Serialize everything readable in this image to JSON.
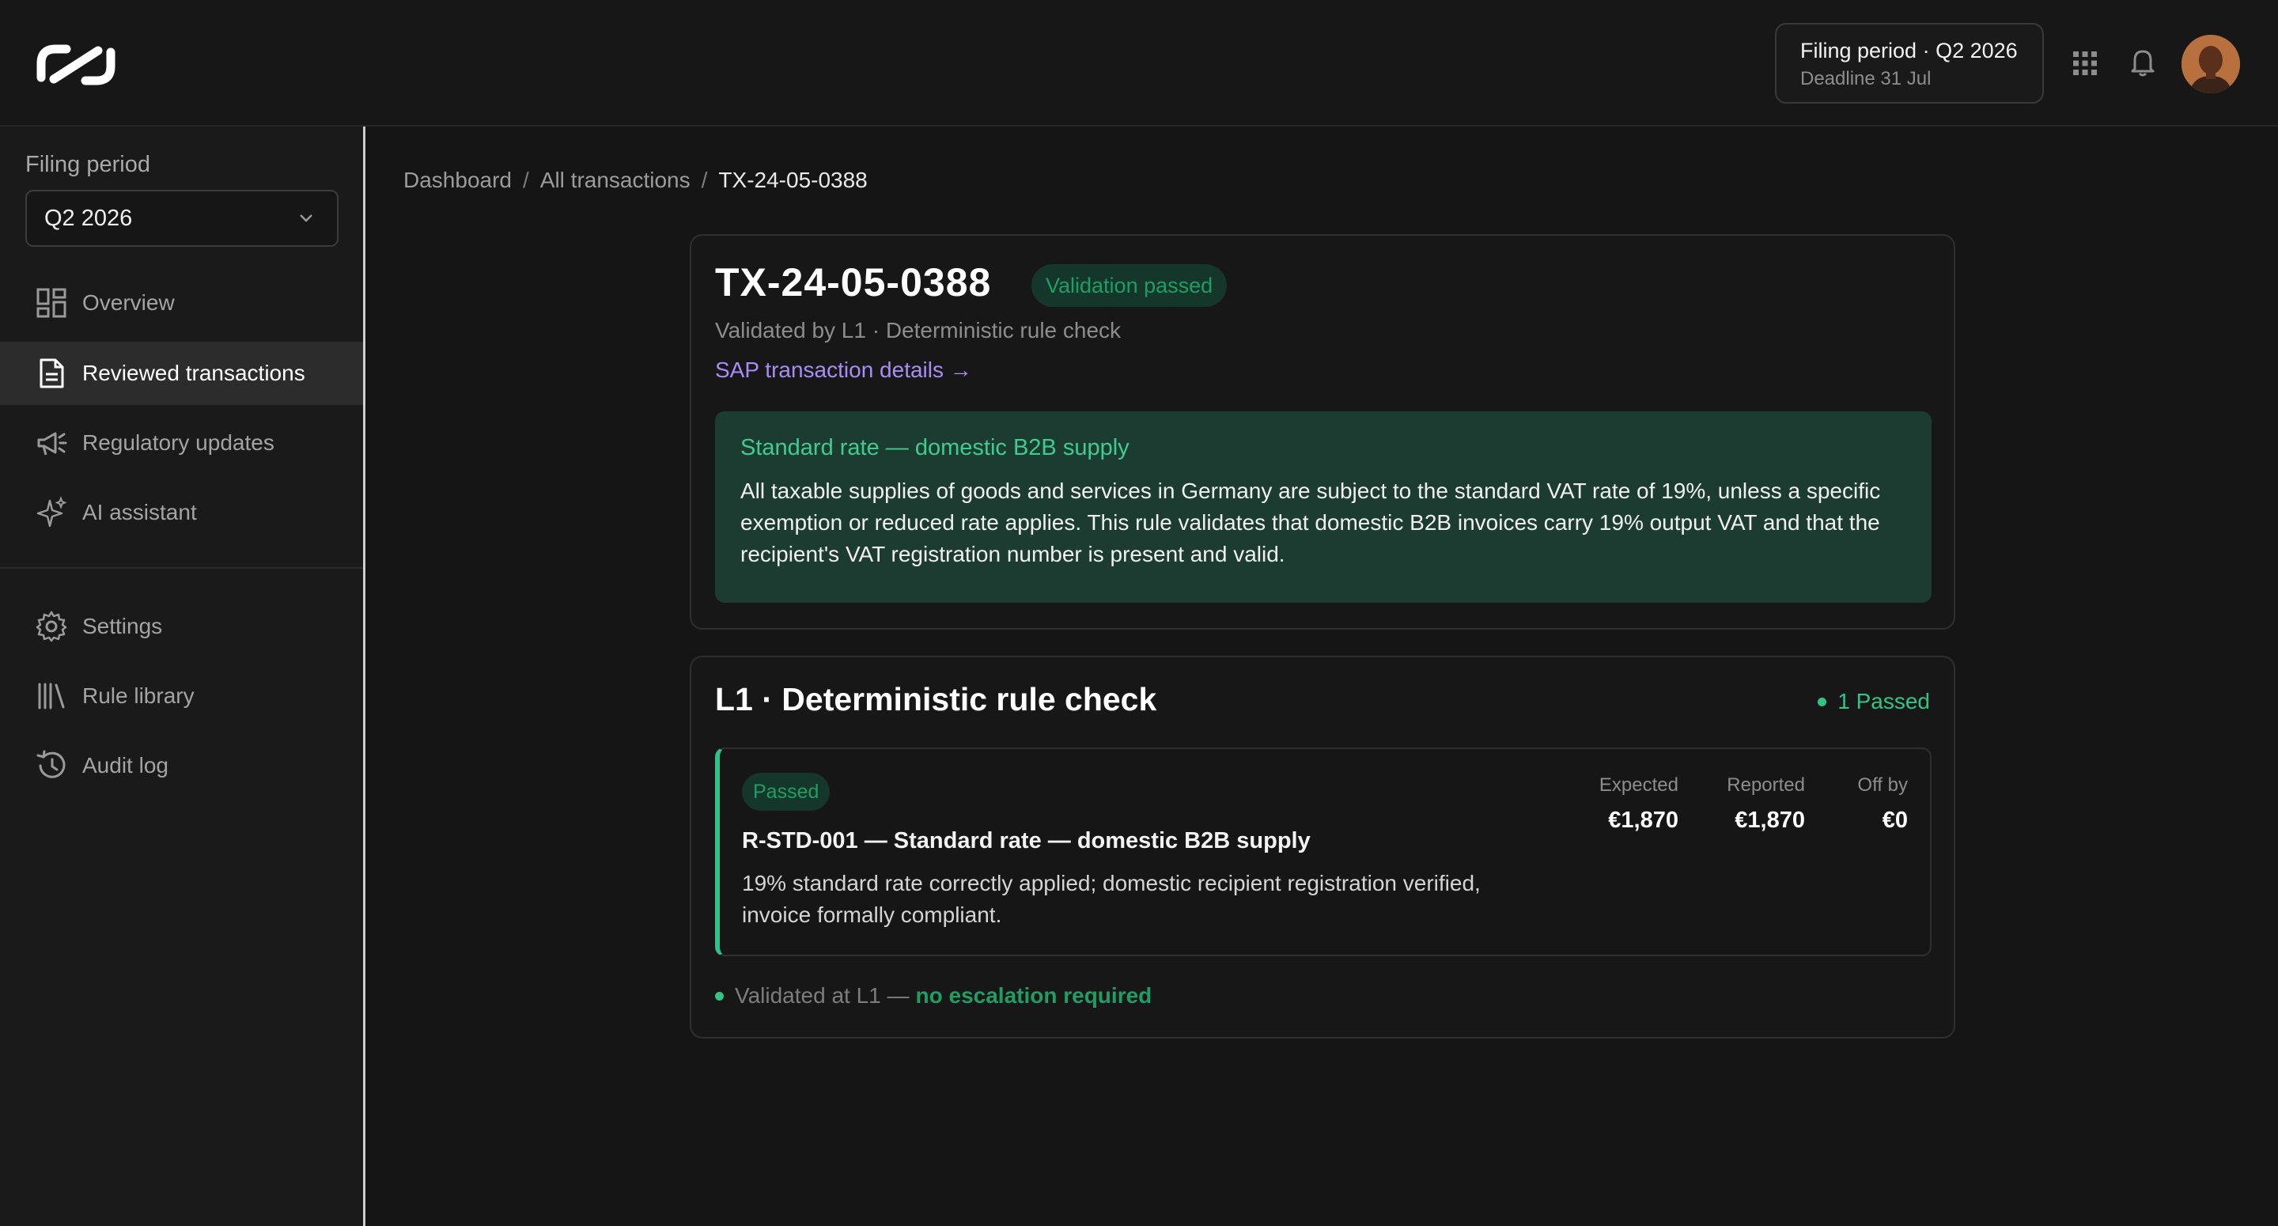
{
  "header": {
    "period_title": "Filing period · Q2 2026",
    "deadline": "Deadline 31 Jul"
  },
  "sidebar": {
    "period_label": "Filing period",
    "period_value": "Q2 2026",
    "items": [
      {
        "label": "Overview",
        "icon": "grid-icon",
        "active": false
      },
      {
        "label": "Reviewed transactions",
        "icon": "document-icon",
        "active": true
      },
      {
        "label": "Regulatory updates",
        "icon": "megaphone-icon",
        "active": false
      },
      {
        "label": "AI assistant",
        "icon": "sparkle-icon",
        "active": false
      },
      {
        "label": "Settings",
        "icon": "gear-icon",
        "active": false
      },
      {
        "label": "Rule library",
        "icon": "library-icon",
        "active": false
      },
      {
        "label": "Audit log",
        "icon": "history-icon",
        "active": false
      }
    ]
  },
  "breadcrumb": {
    "items": [
      "Dashboard",
      "All transactions",
      "TX-24-05-0388"
    ],
    "separator": "/"
  },
  "transaction": {
    "id": "TX-24-05-0388",
    "badge": "Validation passed",
    "validated_by": "Validated by L1 · Deterministic rule check",
    "sap_link": "SAP transaction details →",
    "rule_title": "Standard rate — domestic B2B supply",
    "rule_description": "All taxable supplies of goods and services in Germany are subject to the standard VAT rate of 19%, unless a specific exemption or reduced rate applies. This rule validates that domestic B2B invoices carry 19% output VAT and that the recipient's VAT registration number is present and valid."
  },
  "l1": {
    "title": "L1 · Deterministic rule check",
    "status": "1 Passed",
    "result": {
      "badge": "Passed",
      "rule_name": "R-STD-001 — Standard rate — domestic B2B supply",
      "description": "19% standard rate correctly applied; domestic recipient registration verified, invoice formally compliant.",
      "expected_label": "Expected",
      "expected_value": "€1,870",
      "reported_label": "Reported",
      "reported_value": "€1,870",
      "off_label": "Off by",
      "off_value": "€0"
    },
    "footer_prefix": "Validated at L1 —",
    "footer_highlight": "no escalation required"
  },
  "colors": {
    "background": "#151515",
    "accent_green": "#31c485",
    "link_purple": "#a98cf5",
    "rule_box_bg": "#1d3c31"
  }
}
